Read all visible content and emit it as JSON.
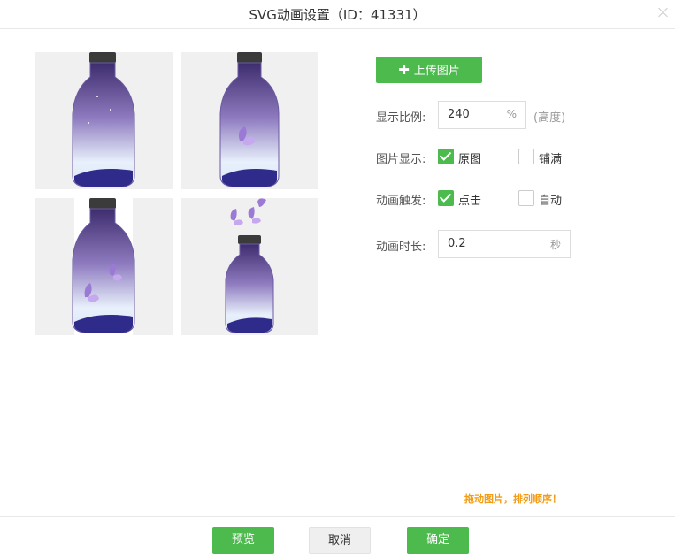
{
  "dialog": {
    "title": "SVG动画设置（ID：41331）"
  },
  "images": [
    {
      "label": "bottle"
    },
    {
      "label": "bottle-with-butterfly"
    },
    {
      "label": "bottle-with-two-butterflies"
    },
    {
      "label": "open-bottle-with-butterflies"
    }
  ],
  "settings": {
    "upload_label": "上传图片",
    "ratio_label": "显示比例:",
    "ratio_value": "240",
    "ratio_unit": "%",
    "ratio_hint": "(高度)",
    "display_label": "图片显示:",
    "display_original": "原图",
    "display_fill": "铺满",
    "display_selected": "原图",
    "trigger_label": "动画触发:",
    "trigger_click": "点击",
    "trigger_auto": "自动",
    "trigger_selected": "点击",
    "duration_label": "动画时长:",
    "duration_value": "0.2",
    "duration_unit": "秒",
    "drag_tip": "拖动图片，排列顺序！"
  },
  "footer": {
    "preview": "预览",
    "cancel": "取消",
    "confirm": "确定"
  },
  "colors": {
    "accent": "#4cba4c",
    "tip": "#f39c12"
  }
}
